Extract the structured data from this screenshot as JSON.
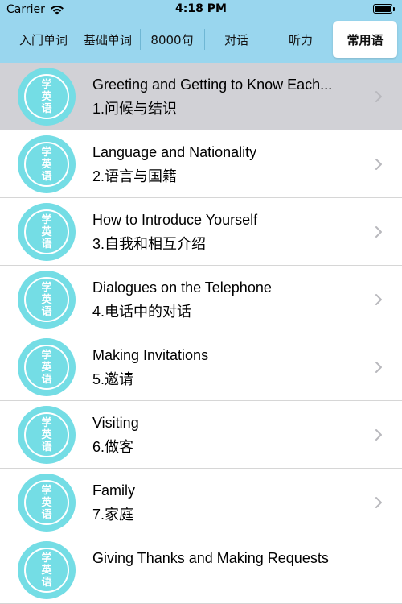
{
  "status_bar": {
    "carrier": "Carrier",
    "time": "4:18 PM",
    "icons": [
      "wifi-icon",
      "battery-icon"
    ]
  },
  "tabs": [
    {
      "label": "入门单词",
      "active": false
    },
    {
      "label": "基础单词",
      "active": false
    },
    {
      "label": "8000句",
      "active": false
    },
    {
      "label": "对话",
      "active": false
    },
    {
      "label": "听力",
      "active": false
    },
    {
      "label": "常用语",
      "active": true
    }
  ],
  "icon_badge": {
    "line1": "学",
    "line2": "英",
    "line3": "语"
  },
  "colors": {
    "header": "#99d6ee",
    "badge": "#74dde5",
    "selected_row": "#d1d1d6"
  },
  "items": [
    {
      "title": "Greeting and Getting to Know Each...",
      "subtitle": "1.问候与结识",
      "selected": true
    },
    {
      "title": "Language and Nationality",
      "subtitle": "2.语言与国籍",
      "selected": false
    },
    {
      "title": "How to Introduce Yourself",
      "subtitle": "3.自我和相互介绍",
      "selected": false
    },
    {
      "title": "Dialogues on the Telephone",
      "subtitle": "4.电话中的对话",
      "selected": false
    },
    {
      "title": "Making Invitations",
      "subtitle": "5.邀请",
      "selected": false
    },
    {
      "title": "Visiting",
      "subtitle": "6.做客",
      "selected": false
    },
    {
      "title": "Family",
      "subtitle": "7.家庭",
      "selected": false
    },
    {
      "title": "Giving Thanks and Making Requests",
      "subtitle": "",
      "selected": false
    }
  ]
}
